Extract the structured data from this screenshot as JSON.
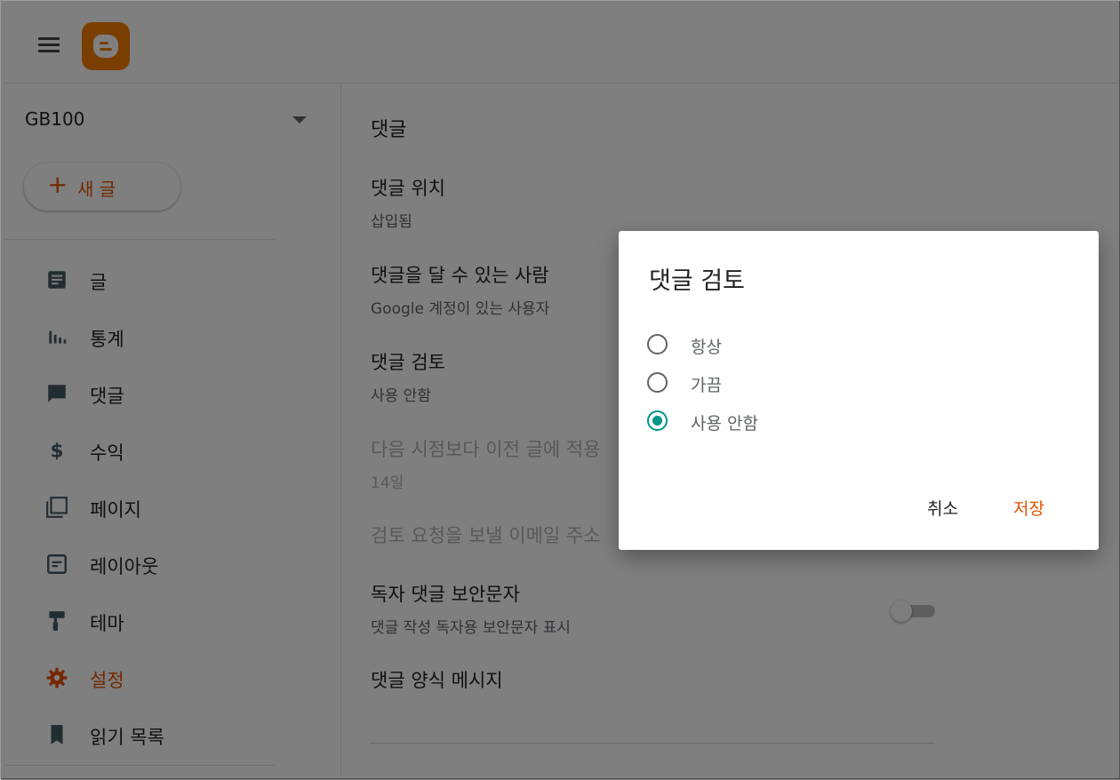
{
  "colors": {
    "accent": "#e65100",
    "brand": "#f57d00",
    "radio": "#009688",
    "scrim": "rgba(0,0,0,0.5)"
  },
  "header": {
    "menu_icon": "hamburger-menu-icon",
    "logo_icon": "blogger-logo-icon"
  },
  "sidebar": {
    "blog_name": "GB100",
    "new_post_label": "새 글",
    "items": [
      {
        "label": "글",
        "icon": "posts-icon"
      },
      {
        "label": "통계",
        "icon": "stats-icon"
      },
      {
        "label": "댓글",
        "icon": "comments-icon"
      },
      {
        "label": "수익",
        "icon": "earnings-icon"
      },
      {
        "label": "페이지",
        "icon": "pages-icon"
      },
      {
        "label": "레이아웃",
        "icon": "layout-icon"
      },
      {
        "label": "테마",
        "icon": "theme-icon"
      },
      {
        "label": "설정",
        "icon": "settings-icon",
        "active": true
      },
      {
        "label": "읽기 목록",
        "icon": "reading-list-icon"
      }
    ]
  },
  "main": {
    "section_title": "댓글",
    "settings": [
      {
        "title": "댓글 위치",
        "value": "삽입됨"
      },
      {
        "title": "댓글을 달 수 있는 사람",
        "value": "Google 계정이 있는 사용자"
      },
      {
        "title": "댓글 검토",
        "value": "사용 안함"
      },
      {
        "title": "다음 시점보다 이전 글에 적용",
        "value": "14일",
        "disabled": true
      },
      {
        "title": "검토 요청을 보낼 이메일 주소",
        "value": "",
        "disabled": true
      },
      {
        "title": "독자 댓글 보안문자",
        "value": "댓글 작성 독자용 보안문자 표시",
        "toggle": false
      },
      {
        "title": "댓글 양식 메시지",
        "value": ""
      }
    ]
  },
  "dialog": {
    "title": "댓글 검토",
    "options": [
      "항상",
      "가끔",
      "사용 안함"
    ],
    "selected": "사용 안함",
    "cancel_label": "취소",
    "save_label": "저장"
  }
}
